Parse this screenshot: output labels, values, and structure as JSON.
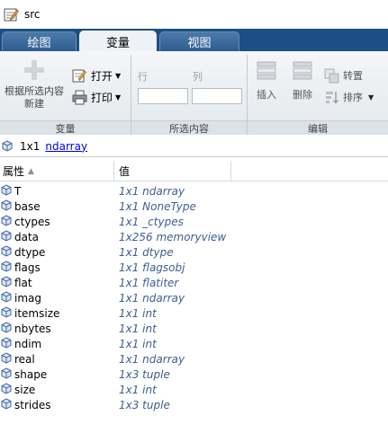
{
  "window": {
    "title": "src"
  },
  "tabs": [
    {
      "label": "绘图",
      "active": false
    },
    {
      "label": "变量",
      "active": true
    },
    {
      "label": "视图",
      "active": false
    }
  ],
  "ribbon": {
    "new_from_selection_line1": "根据所选内容",
    "new_from_selection_line2": "新建",
    "open_label": "打开",
    "print_label": "打印",
    "group_variable": "变量",
    "row_label": "行",
    "col_label": "列",
    "group_selection": "所选内容",
    "insert_label": "插入",
    "delete_label": "删除",
    "transpose_label": "转置",
    "sort_label": "排序",
    "group_edit": "编辑"
  },
  "breadcrumb": {
    "size": "1x1",
    "type_link": "ndarray"
  },
  "table": {
    "col_property": "属性",
    "col_value": "值",
    "rows": [
      {
        "name": "T",
        "value": "1x1 ndarray"
      },
      {
        "name": "base",
        "value": "1x1 NoneType"
      },
      {
        "name": "ctypes",
        "value": "1x1 _ctypes"
      },
      {
        "name": "data",
        "value": "1x256 memoryview"
      },
      {
        "name": "dtype",
        "value": "1x1 dtype"
      },
      {
        "name": "flags",
        "value": "1x1 flagsobj"
      },
      {
        "name": "flat",
        "value": "1x1 flatiter"
      },
      {
        "name": "imag",
        "value": "1x1 ndarray"
      },
      {
        "name": "itemsize",
        "value": "1x1 int"
      },
      {
        "name": "nbytes",
        "value": "1x1 int"
      },
      {
        "name": "ndim",
        "value": "1x1 int"
      },
      {
        "name": "real",
        "value": "1x1 ndarray"
      },
      {
        "name": "shape",
        "value": "1x3 tuple"
      },
      {
        "name": "size",
        "value": "1x1 int"
      },
      {
        "name": "strides",
        "value": "1x3 tuple"
      }
    ]
  },
  "colors": {
    "tab_strip": "#1c4f83",
    "value_text": "#3c5f93",
    "link": "#0000ee"
  }
}
